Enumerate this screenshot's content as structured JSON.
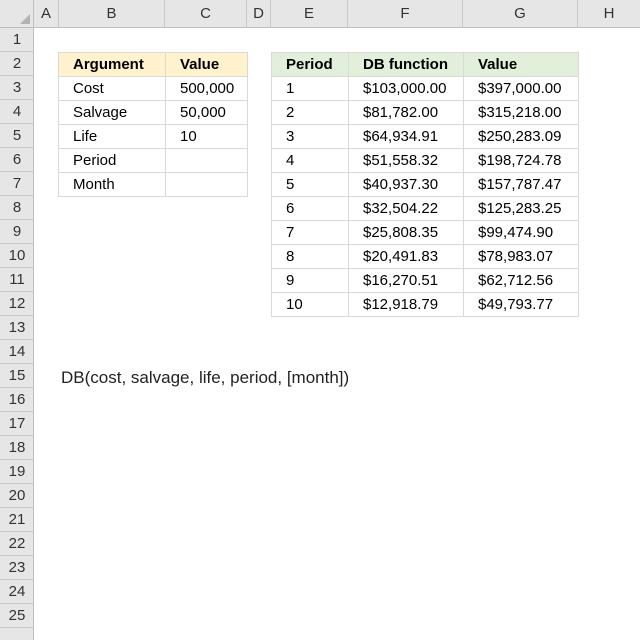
{
  "columns": [
    "A",
    "B",
    "C",
    "D",
    "E",
    "F",
    "G",
    "H"
  ],
  "rows": [
    "1",
    "2",
    "3",
    "4",
    "5",
    "6",
    "7",
    "8",
    "9",
    "10",
    "11",
    "12",
    "13",
    "14",
    "15",
    "16",
    "17",
    "18",
    "19",
    "20",
    "21",
    "22",
    "23",
    "24",
    "25"
  ],
  "arguments_table": {
    "headers": [
      "Argument",
      "Value"
    ],
    "rows": [
      [
        "Cost",
        "500,000"
      ],
      [
        "Salvage",
        "50,000"
      ],
      [
        "Life",
        "10"
      ],
      [
        "Period",
        ""
      ],
      [
        "Month",
        ""
      ]
    ]
  },
  "period_table": {
    "headers": [
      "Period",
      "DB function",
      "Value"
    ],
    "rows": [
      [
        "1",
        "$103,000.00",
        "$397,000.00"
      ],
      [
        "2",
        "$81,782.00",
        "$315,218.00"
      ],
      [
        "3",
        "$64,934.91",
        "$250,283.09"
      ],
      [
        "4",
        "$51,558.32",
        "$198,724.78"
      ],
      [
        "5",
        "$40,937.30",
        "$157,787.47"
      ],
      [
        "6",
        "$32,504.22",
        "$125,283.25"
      ],
      [
        "7",
        "$25,808.35",
        "$99,474.90"
      ],
      [
        "8",
        "$20,491.83",
        "$78,983.07"
      ],
      [
        "9",
        "$16,270.51",
        "$62,712.56"
      ],
      [
        "10",
        "$12,918.79",
        "$49,793.77"
      ]
    ]
  },
  "formula_text": "DB(cost, salvage, life, period, [month])",
  "colors": {
    "header_bg": "#e6e6e6",
    "arguments_header_bg": "#fff2cc",
    "period_header_bg": "#e2efda",
    "cell_border": "#d9d9d9"
  }
}
